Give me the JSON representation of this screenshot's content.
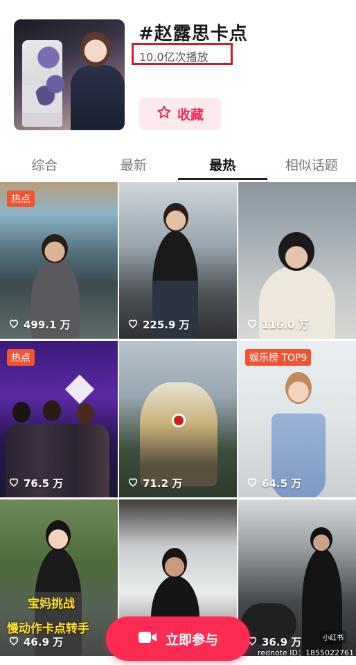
{
  "topic": {
    "title": "#赵露思卡点",
    "play_count": "10.0亿次播放",
    "favorite_label": "收藏"
  },
  "tabs": [
    {
      "label": "综合",
      "active": false
    },
    {
      "label": "最新",
      "active": false
    },
    {
      "label": "最热",
      "active": true
    },
    {
      "label": "相似话题",
      "active": false
    }
  ],
  "posts": [
    {
      "likes": "499.1 万",
      "badge": "热点"
    },
    {
      "likes": "225.9 万",
      "badge": ""
    },
    {
      "likes": "116.0 万",
      "badge": ""
    },
    {
      "likes": "76.5 万",
      "badge": "热点"
    },
    {
      "likes": "71.2 万",
      "badge": ""
    },
    {
      "likes": "64.5 万",
      "badge": "娱乐榜 TOP9"
    },
    {
      "likes": "46.9 万",
      "badge": "",
      "overlay_line1": "宝妈挑战",
      "overlay_line2": "慢动作卡点转手"
    },
    {
      "likes": "",
      "badge": ""
    },
    {
      "likes": "36.9 万",
      "badge": ""
    }
  ],
  "cta": {
    "label": "立即参与"
  },
  "watermark": {
    "text": "rednote ID：1855022761",
    "logo": "小红书"
  },
  "colors": {
    "accent": "#fd2a54",
    "badge": "#f05432",
    "highlight_box": "#d7182a"
  }
}
